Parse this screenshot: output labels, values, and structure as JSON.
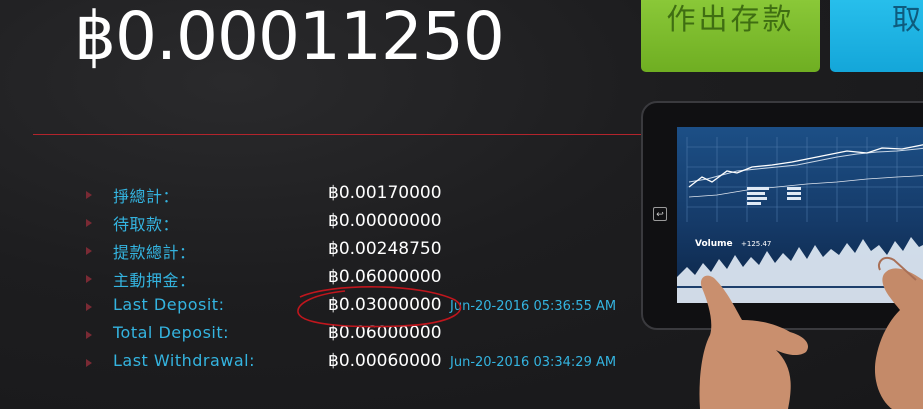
{
  "balance": {
    "amount": "฿0.00011250"
  },
  "buttons": {
    "deposit": "作出存款",
    "withdraw": "取"
  },
  "stats": [
    {
      "label": "掙總計：",
      "value": "฿0.00170000",
      "time": ""
    },
    {
      "label": "待取款：",
      "value": "฿0.00000000",
      "time": ""
    },
    {
      "label": "提款總計：",
      "value": "฿0.00248750",
      "time": ""
    },
    {
      "label": "主動押金：",
      "value": "฿0.06000000",
      "time": ""
    },
    {
      "label": "Last Deposit:",
      "value": "฿0.03000000",
      "time": "Jun-20-2016 05:36:55 AM"
    },
    {
      "label": "Total Deposit:",
      "value": "฿0.06000000",
      "time": ""
    },
    {
      "label": "Last Withdrawal:",
      "value": "฿0.00060000",
      "time": "Jun-20-2016 03:34:29 AM"
    }
  ],
  "illustration": {
    "volume_label": "Volume",
    "volume_value": "+125.47"
  },
  "colors": {
    "accent": "#34b4e0",
    "divider": "#b3242c",
    "deposit": "#8fcd3c",
    "withdraw": "#14a6d9",
    "annotation": "#c0161d"
  }
}
